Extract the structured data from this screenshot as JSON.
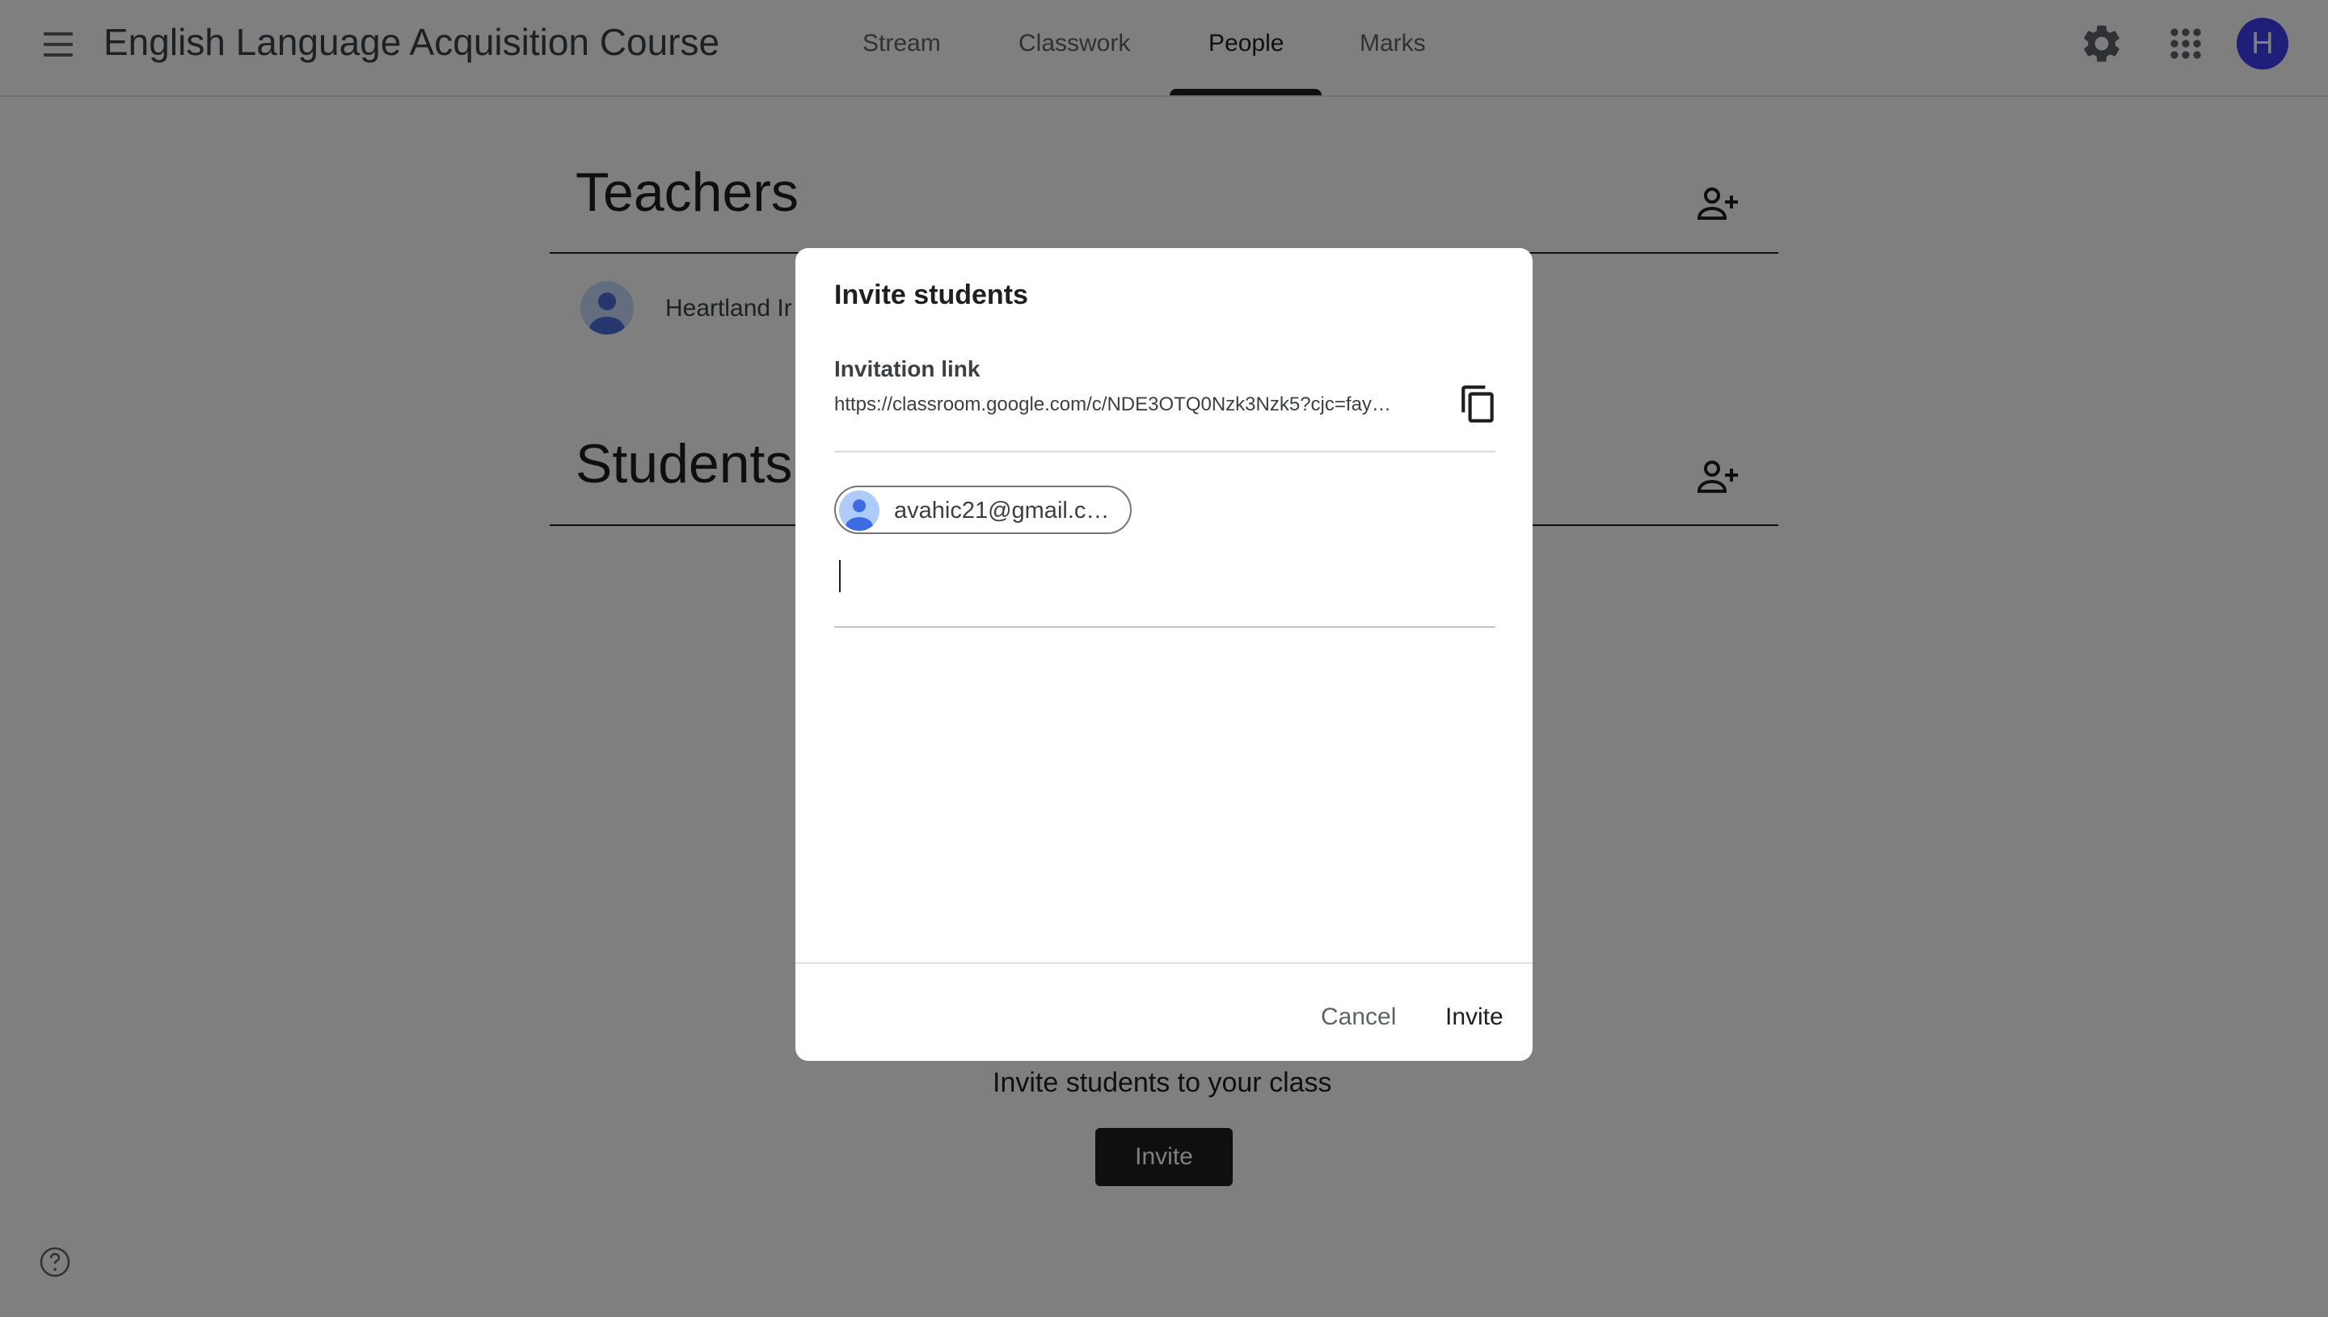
{
  "header": {
    "title": "English Language Acquisition Course",
    "tabs": [
      {
        "label": "Stream"
      },
      {
        "label": "Classwork"
      },
      {
        "label": "People",
        "active": true
      },
      {
        "label": "Marks"
      }
    ],
    "avatar_initial": "H",
    "icons": [
      "menu-icon",
      "settings-icon",
      "apps-grid-icon"
    ],
    "accent_color": "#3f3df0"
  },
  "people": {
    "teachers_title": "Teachers",
    "teacher_name": "Heartland Ir",
    "students_title": "Students",
    "empty_message": "Invite students to your class",
    "invite_button": "Invite"
  },
  "dialog": {
    "title": "Invite students",
    "link_label": "Invitation link",
    "link_url": "https://classroom.google.com/c/NDE3OTQ0Nzk3Nzk5?cjc=fay…",
    "chip_email": "avahic21@gmail.c…",
    "input_value": "",
    "cancel_label": "Cancel",
    "invite_label": "Invite"
  }
}
